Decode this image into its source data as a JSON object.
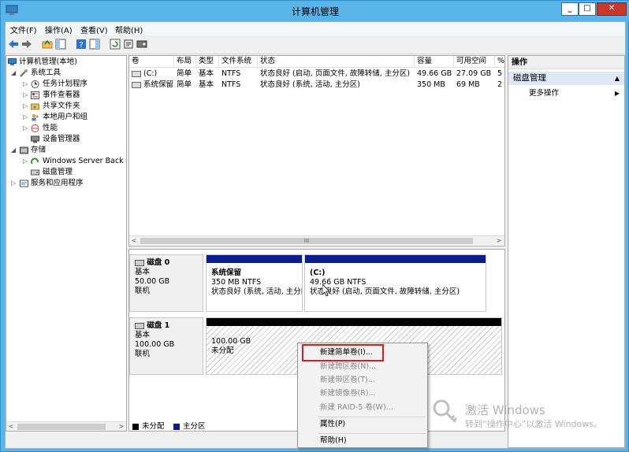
{
  "window": {
    "title": "计算机管理"
  },
  "menubar": [
    "文件(F)",
    "操作(A)",
    "查看(V)",
    "帮助(H)"
  ],
  "tree": {
    "items": [
      {
        "label": "计算机管理(本地)",
        "level": 0,
        "icon": "computer-icon"
      },
      {
        "label": "系统工具",
        "level": 1,
        "icon": "tools-icon",
        "expanded": true
      },
      {
        "label": "任务计划程序",
        "level": 2,
        "icon": "clock-icon"
      },
      {
        "label": "事件查看器",
        "level": 2,
        "icon": "event-icon"
      },
      {
        "label": "共享文件夹",
        "level": 2,
        "icon": "folder-icon"
      },
      {
        "label": "本地用户和组",
        "level": 2,
        "icon": "users-icon"
      },
      {
        "label": "性能",
        "level": 2,
        "icon": "performance-icon"
      },
      {
        "label": "设备管理器",
        "level": 2,
        "icon": "device-icon"
      },
      {
        "label": "存储",
        "level": 1,
        "icon": "storage-icon",
        "expanded": true
      },
      {
        "label": "Windows Server Back",
        "level": 2,
        "icon": "backup-icon"
      },
      {
        "label": "磁盘管理",
        "level": 2,
        "icon": "disk-icon"
      },
      {
        "label": "服务和应用程序",
        "level": 1,
        "icon": "services-icon"
      }
    ]
  },
  "volume_list": {
    "headers": [
      "卷",
      "布局",
      "类型",
      "文件系统",
      "状态",
      "容量",
      "可用空间",
      "%"
    ],
    "rows": [
      [
        "(C:)",
        "简单",
        "基本",
        "NTFS",
        "状态良好 (启动, 页面文件, 故障转储, 主分区)",
        "49.66 GB",
        "27.09 GB",
        "5"
      ],
      [
        "系统保留",
        "简单",
        "基本",
        "NTFS",
        "状态良好 (系统, 活动, 主分区)",
        "350 MB",
        "69 MB",
        "2"
      ]
    ],
    "scroll_mark": "III"
  },
  "disks": [
    {
      "name": "磁盘 0",
      "type": "基本",
      "size": "50.00 GB",
      "status": "联机",
      "volumes": [
        {
          "name": "系统保留",
          "size": "350 MB NTFS",
          "status": "状态良好 (系统, 活动, 主分区)"
        },
        {
          "name": "(C:)",
          "size": "49.66 GB NTFS",
          "status": "状态良好 (启动, 页面文件, 故障转储, 主分区)"
        }
      ]
    },
    {
      "name": "磁盘 1",
      "type": "基本",
      "size": "100.00 GB",
      "status": "联机",
      "volumes": [
        {
          "name": "",
          "size": "100.00 GB",
          "status": "未分配"
        }
      ]
    }
  ],
  "legend": [
    "未分配",
    "主分区"
  ],
  "legend_colors": [
    "#000000",
    "#0a1d8c"
  ],
  "actions": {
    "header": "操作",
    "section": "磁盘管理",
    "more": "更多操作"
  },
  "context_menu": {
    "items": [
      {
        "label": "新建简单卷(I)...",
        "enabled": true
      },
      {
        "label": "新建跨区卷(N)...",
        "enabled": false
      },
      {
        "label": "新建带区卷(T)...",
        "enabled": false
      },
      {
        "label": "新建镜像卷(R)...",
        "enabled": false
      },
      {
        "label": "新建 RAID-5 卷(W)...",
        "enabled": false
      },
      {
        "label": "属性(P)",
        "enabled": true
      },
      {
        "label": "帮助(H)",
        "enabled": true
      }
    ]
  },
  "watermark": {
    "line1": "激活 Windows",
    "line2": "转到“操作中心”以激活 Windows。"
  }
}
